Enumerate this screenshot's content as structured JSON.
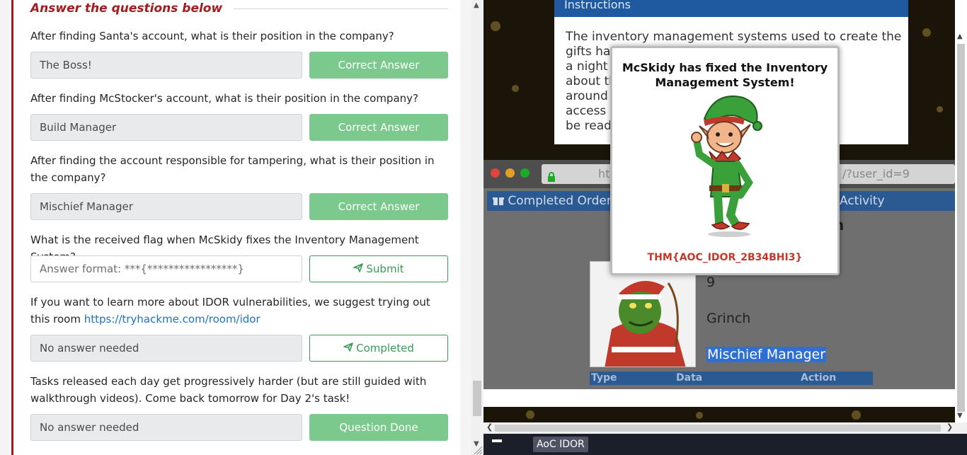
{
  "task_panel": {
    "heading": "Answer the questions below",
    "questions": [
      {
        "text": "After finding Santa's account, what is their position in the company?",
        "answer": "The Boss!",
        "button": "Correct Answer"
      },
      {
        "text": "After finding McStocker's account, what is their position in the company?",
        "answer": "Build Manager",
        "button": "Correct Answer"
      },
      {
        "text": "After finding the account responsible for tampering, what is their position in the company?",
        "answer": "Mischief Manager",
        "button": "Correct Answer"
      },
      {
        "text": "What is the received flag when McSkidy fixes the Inventory Management System?",
        "placeholder": "Answer format: ***{*****************}",
        "button": "Submit",
        "button_icon": "paper-plane-icon"
      },
      {
        "text": "If you want to learn more about IDOR vulnerabilities, we suggest trying out this room",
        "link": "https://tryhackme.com/room/idor",
        "answer": "No answer needed",
        "button": "Completed",
        "button_icon": "paper-plane-icon"
      },
      {
        "text": "Tasks released each day get progressively harder (but are still guided with walkthrough videos). Come back tomorrow for Day 2's task!",
        "answer": "No answer needed",
        "button": "Question Done"
      }
    ]
  },
  "vm": {
    "instructions": {
      "title": "Instructions",
      "text": "The inventory management systems used to create the gifts ha… …elves. It's a night… …panicking about th… …managers around… …now get access a… …on track to be read…",
      "lines": [
        "The inventory management systems used to create the",
        "gifts ha                                      elves. It's",
        "a night s                                    panicking",
        "about th                                     managers",
        "around                                       how get",
        "access a                                   on track to",
        "be read"
      ]
    },
    "browser": {
      "url_left": "ht",
      "url_right": "/?user_id=9",
      "tab_orders": "Completed Orders",
      "tab_activity": "Activity",
      "heading_fragment": "n",
      "profile_values": [
        "9",
        "Grinch",
        "Mischief Manager"
      ],
      "activity_columns": [
        "Type",
        "Data",
        "Action"
      ]
    },
    "modal": {
      "title": "McSkidy has fixed the Inventory Management System!",
      "flag": "THM{AOC_IDOR_2B34BHI3}"
    }
  },
  "taskbar": {
    "item": "AoC IDOR"
  },
  "colors": {
    "accent_red": "#a11d21",
    "success_green": "#7cc98d",
    "link_blue": "#1a73c8",
    "flag_red": "#c0392b",
    "selection_blue": "#2e6fd6"
  }
}
